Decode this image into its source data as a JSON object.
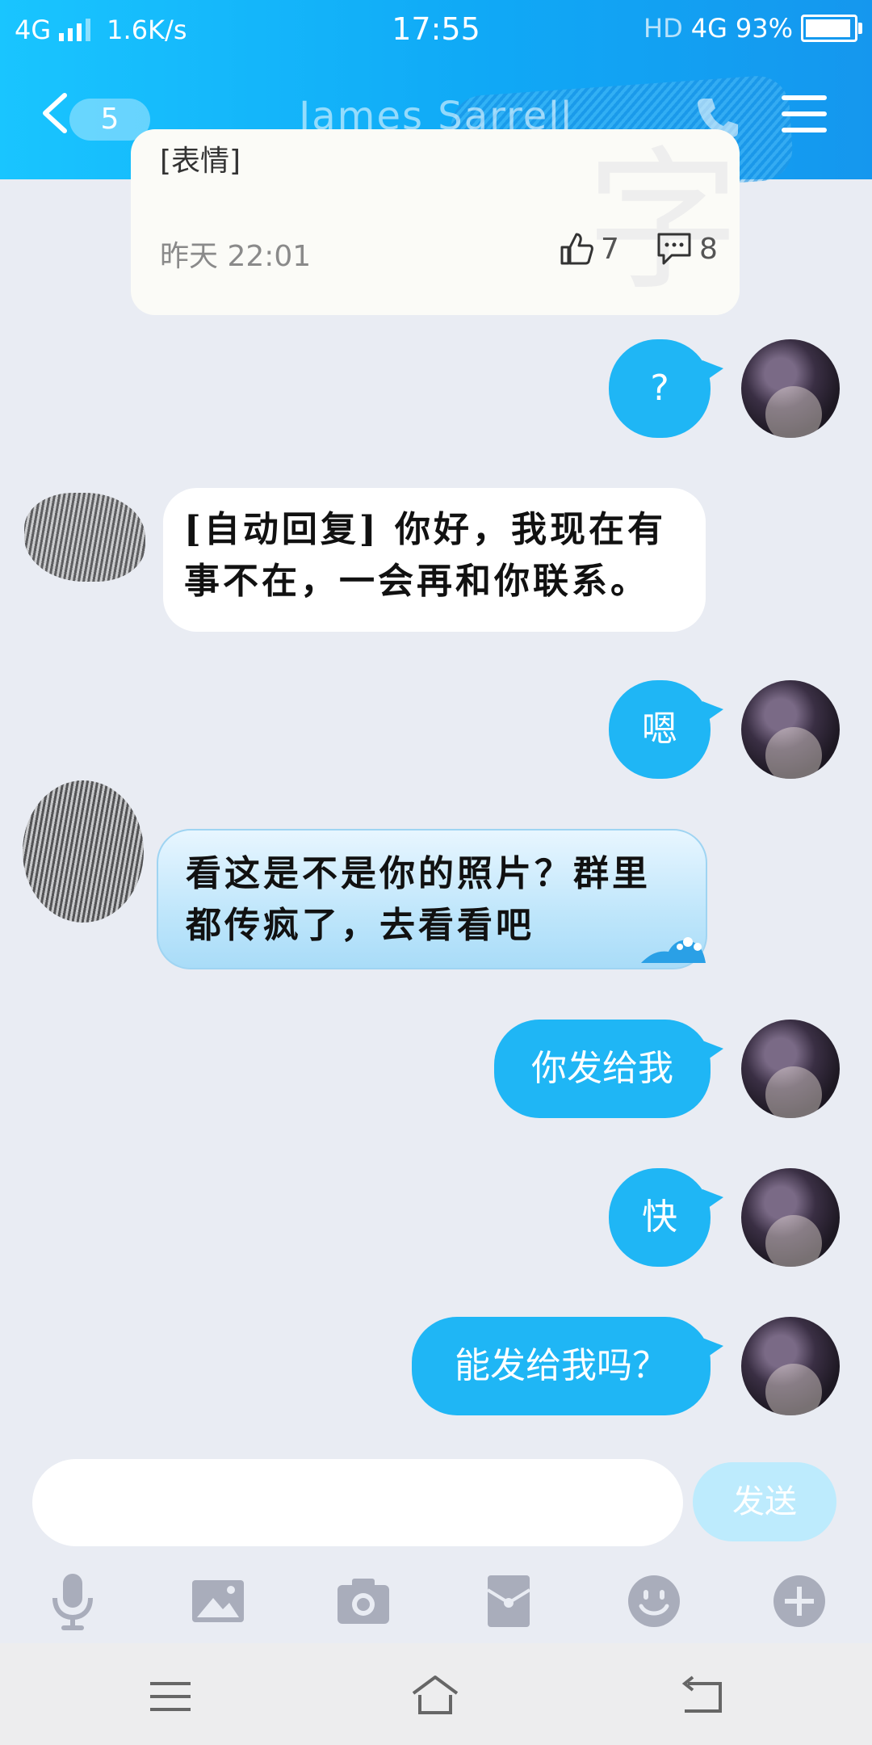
{
  "status_bar": {
    "network": "4G",
    "speed": "1.6K/s",
    "time": "17:55",
    "right_icons": "HD",
    "network2": "4G",
    "battery": "93%",
    "battery_level": 0.93
  },
  "header": {
    "unread_badge": "5",
    "contact_name": "James Sarrell"
  },
  "post_card": {
    "partial_text": "[表情]",
    "time": "昨天 22:01",
    "likes": "7",
    "comments": "8"
  },
  "messages": [
    {
      "from": "me",
      "text": "?"
    },
    {
      "from": "other",
      "text": "[自动回复] 你好，我现在有事不在，一会再和你联系。"
    },
    {
      "from": "me",
      "text": "嗯"
    },
    {
      "from": "other",
      "text": "看这是不是你的照片？群里都传疯了，去看看吧"
    },
    {
      "from": "me",
      "text": "你发给我"
    },
    {
      "from": "me",
      "text": "快"
    },
    {
      "from": "me",
      "text": "能发给我吗？"
    }
  ],
  "input": {
    "placeholder": "",
    "send_label": "发送"
  },
  "toolbar": {
    "icons": [
      "microphone-icon",
      "image-icon",
      "camera-icon",
      "red-packet-icon",
      "emoji-icon",
      "plus-icon"
    ]
  },
  "colors": {
    "header_start": "#19c5ff",
    "header_end": "#1597ee",
    "bubble_me": "#1fb6f5",
    "background": "#e9ecf3"
  }
}
